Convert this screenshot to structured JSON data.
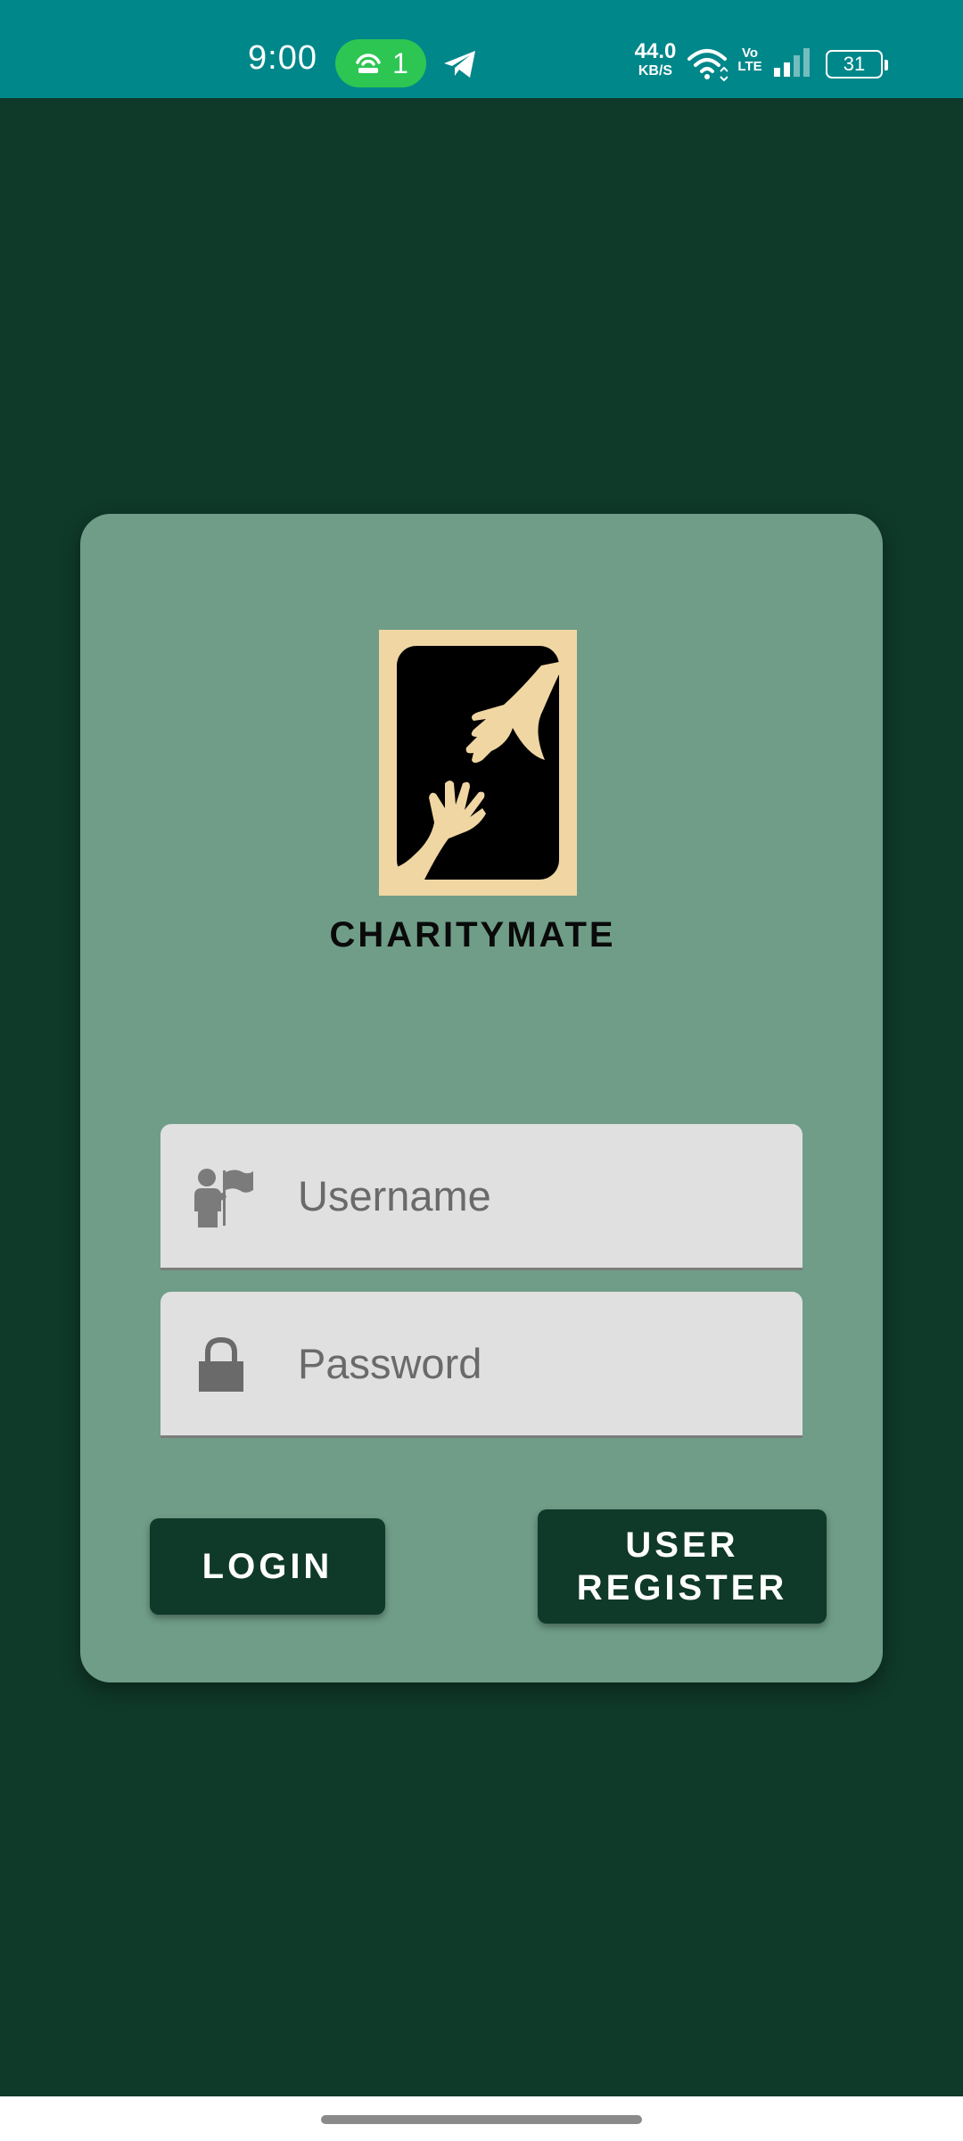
{
  "status_bar": {
    "time": "9:00",
    "hotspot_count": "1",
    "net_speed_value": "44.0",
    "net_speed_unit": "KB/S",
    "volte_top": "Vo",
    "volte_bottom": "LTE",
    "battery": "31",
    "color": "#00878a"
  },
  "app": {
    "name": "CHARITYMATE",
    "logo_icon": "reaching-hands-icon",
    "background_color": "#0f3929",
    "card_color": "#6f9d88"
  },
  "form": {
    "username_placeholder": "Username",
    "username_value": "",
    "username_icon": "volunteer-flag-icon",
    "password_placeholder": "Password",
    "password_value": "",
    "password_icon": "lock-icon"
  },
  "buttons": {
    "login_label": "LOGIN",
    "register_label": "USER\nREGISTER"
  }
}
